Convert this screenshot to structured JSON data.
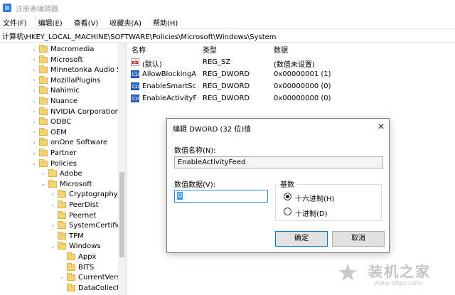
{
  "window": {
    "title": "注册表编辑器"
  },
  "menu": [
    "文件(F)",
    "编辑(E)",
    "查看(V)",
    "收藏夹(A)",
    "帮助(H)"
  ],
  "address": "计算机\\HKEY_LOCAL_MACHINE\\SOFTWARE\\Policies\\Microsoft\\Windows\\System",
  "tree": [
    {
      "label": "Macromedia",
      "level": 0,
      "expanded": false,
      "has_children": true
    },
    {
      "label": "Microsoft",
      "level": 0,
      "expanded": false,
      "has_children": true
    },
    {
      "label": "Minnetonka Audio S",
      "level": 0,
      "expanded": false,
      "has_children": true
    },
    {
      "label": "MozillaPlugins",
      "level": 0,
      "expanded": false,
      "has_children": true
    },
    {
      "label": "Nahimic",
      "level": 0,
      "expanded": false,
      "has_children": true
    },
    {
      "label": "Nuance",
      "level": 0,
      "expanded": false,
      "has_children": true
    },
    {
      "label": "NVIDIA Corporation",
      "level": 0,
      "expanded": false,
      "has_children": true
    },
    {
      "label": "ODBC",
      "level": 0,
      "expanded": false,
      "has_children": true
    },
    {
      "label": "OEM",
      "level": 0,
      "expanded": false,
      "has_children": true
    },
    {
      "label": "onOne Software",
      "level": 0,
      "expanded": false,
      "has_children": true
    },
    {
      "label": "Partner",
      "level": 0,
      "expanded": false,
      "has_children": true
    },
    {
      "label": "Policies",
      "level": 0,
      "expanded": true,
      "has_children": true
    },
    {
      "label": "Adobe",
      "level": 1,
      "expanded": false,
      "has_children": true
    },
    {
      "label": "Microsoft",
      "level": 1,
      "expanded": true,
      "has_children": true
    },
    {
      "label": "Cryptography",
      "level": 2,
      "expanded": false,
      "has_children": true
    },
    {
      "label": "PeerDist",
      "level": 2,
      "expanded": false,
      "has_children": true
    },
    {
      "label": "Peernet",
      "level": 2,
      "expanded": false,
      "has_children": false
    },
    {
      "label": "SystemCertific",
      "level": 2,
      "expanded": false,
      "has_children": true
    },
    {
      "label": "TPM",
      "level": 2,
      "expanded": false,
      "has_children": false
    },
    {
      "label": "Windows",
      "level": 2,
      "expanded": true,
      "has_children": true
    },
    {
      "label": "Appx",
      "level": 3,
      "expanded": false,
      "has_children": false
    },
    {
      "label": "BITS",
      "level": 3,
      "expanded": false,
      "has_children": false
    },
    {
      "label": "CurrentVers",
      "level": 3,
      "expanded": false,
      "has_children": true
    },
    {
      "label": "DataCollect",
      "level": 3,
      "expanded": false,
      "has_children": false
    }
  ],
  "list": {
    "headers": {
      "name": "名称",
      "type": "类型",
      "data": "数据"
    },
    "rows": [
      {
        "icon": "string-value-icon",
        "badge": "ab",
        "name": "(默认)",
        "type": "REG_SZ",
        "data": "(数值未设置)"
      },
      {
        "icon": "dword-value-icon",
        "badge": "010",
        "name": "AllowBlockingA...",
        "type": "REG_DWORD",
        "data": "0x00000001 (1)"
      },
      {
        "icon": "dword-value-icon",
        "badge": "010",
        "name": "EnableSmartScr",
        "type": "REG_DWORD",
        "data": "0x00000000 (0)"
      },
      {
        "icon": "dword-value-icon",
        "badge": "010",
        "name": "EnableActivityFe",
        "type": "REG_DWORD",
        "data": "0x00000000 (0)"
      }
    ]
  },
  "dialog": {
    "title": "编辑 DWORD (32 位)值",
    "name_label": "数值名称(N):",
    "name_value": "EnableActivityFeed",
    "data_label": "数值数据(V):",
    "data_value": "0",
    "radix_label": "基数",
    "hex_label": "十六进制(H)",
    "dec_label": "十进制(D)",
    "radix_selected": "hex",
    "ok": "确定",
    "cancel": "取消",
    "close_glyph": "✕"
  },
  "watermark": {
    "brand": "装机之家",
    "url": "www.lotpc.com"
  },
  "colors": {
    "folder": "#f5d374",
    "dword_icon": "#2a66c4",
    "accent": "#0078d7",
    "selection": "#3399ff"
  }
}
